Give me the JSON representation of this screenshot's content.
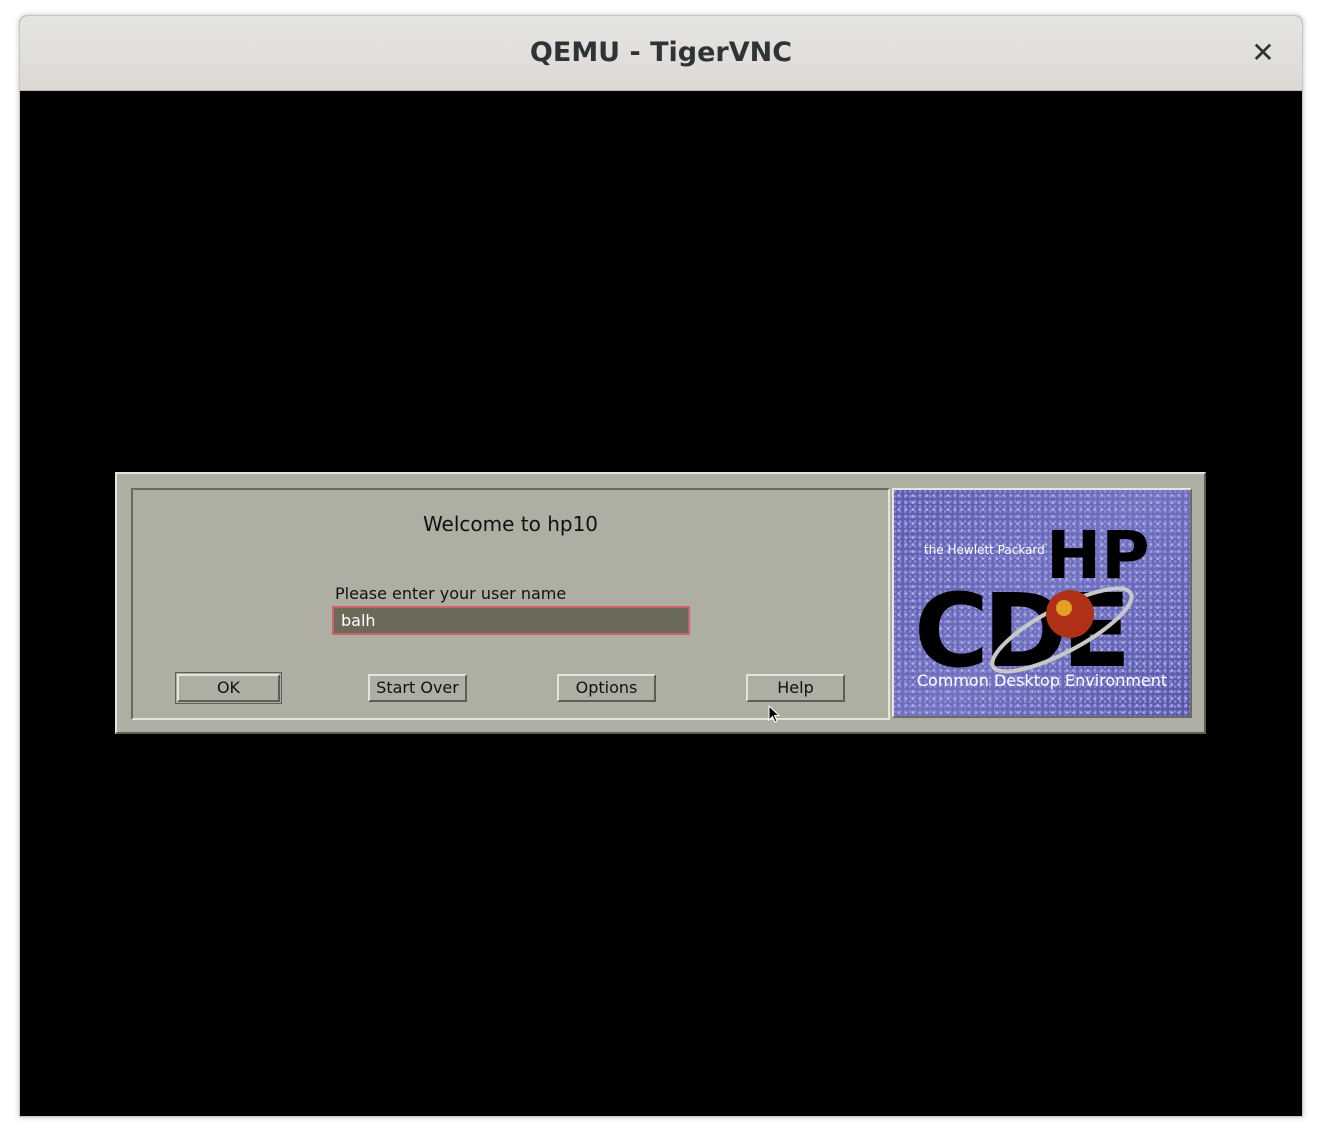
{
  "window": {
    "title": "QEMU - TigerVNC",
    "close_glyph": "✕"
  },
  "login": {
    "welcome": "Welcome to hp10",
    "prompt": "Please enter your user name",
    "username_value": "balh",
    "buttons": {
      "ok": "OK",
      "start_over": "Start Over",
      "options": "Options",
      "help": "Help"
    }
  },
  "logo": {
    "tagline": "the Hewlett Packard",
    "brand": "HP",
    "product": "CDE",
    "subtitle": "Common Desktop Environment"
  },
  "colors": {
    "dialog_bg": "#aeaea3",
    "input_bg": "#6b6a58",
    "input_border": "#d0606a",
    "logo_bg": "#6464b8"
  }
}
